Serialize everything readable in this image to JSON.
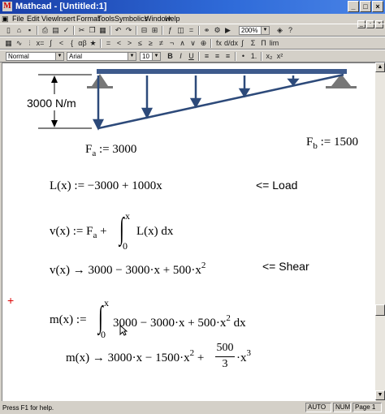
{
  "window": {
    "title": "Mathcad - [Untitled:1]",
    "app_icon": "mathcad-icon",
    "minimize": "_",
    "maximize": "□",
    "close": "×"
  },
  "menu": [
    "File",
    "Edit",
    "View",
    "Insert",
    "Format",
    "Tools",
    "Symbolics",
    "Window",
    "Help"
  ],
  "toolbar": {
    "zoom": "200%",
    "style": "Normal",
    "font": "Arial",
    "size": "10",
    "bold": "B",
    "italic": "I",
    "underline": "U"
  },
  "worksheet": {
    "load_label": "3000 N/m",
    "fa": {
      "lhs": "F",
      "sub": "a",
      "op": " := ",
      "rhs": "3000"
    },
    "fb": {
      "lhs": "F",
      "sub": "b",
      "op": " := ",
      "rhs": "1500"
    },
    "load_eq": "L(x) := −3000 + 1000x",
    "load_note": "<= Load",
    "v_def": {
      "lhs": "v(x) := F",
      "sub": "a",
      "plus": " +",
      "upper": "x",
      "lower": "0",
      "integrand": "L(x) dx"
    },
    "v_result": {
      "text": "v(x) → 3000 − 3000·x + 500·x",
      "exp": "2"
    },
    "shear_note": "<=  Shear",
    "m_def": {
      "lhs": "m(x) :=",
      "upper": "x",
      "lower": "0",
      "integrand": "3000 − 3000·x + 500·x",
      "exp": "2",
      "tail": " dx"
    },
    "m_result": {
      "part1": "m(x) → 3000·x − 1500·x",
      "exp1": "2",
      "plus": " +",
      "num": "500",
      "den": "3",
      "tail": "·x",
      "exp2": "3"
    }
  },
  "status": {
    "help": "Press F1 for help.",
    "mode": "AUTO",
    "num": "NUM",
    "page": "Page 1"
  }
}
